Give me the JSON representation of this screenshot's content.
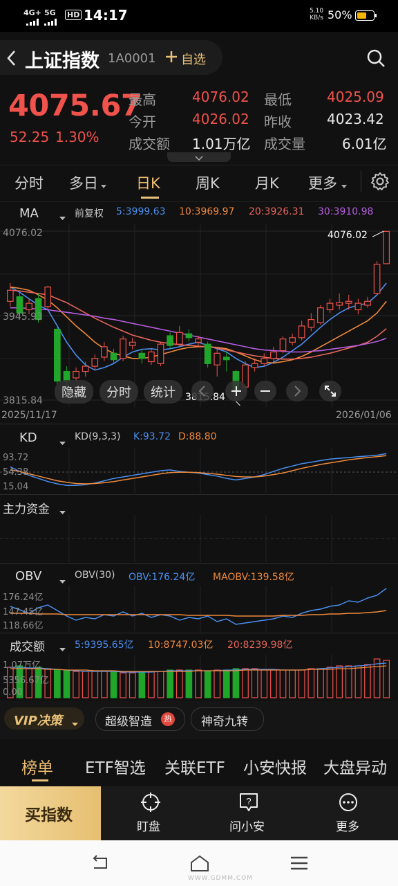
{
  "status_bar": {
    "signal": "4G+",
    "signal2": "5G",
    "hd": "HD",
    "time": "14:17",
    "net_speed_value": "5.10",
    "net_speed_unit": "KB/s",
    "battery": "50%"
  },
  "header": {
    "back_icon": "chevron-left-icon",
    "title": "上证指数",
    "code": "1A0001",
    "watchlist_label": "自选",
    "search_icon": "search-icon"
  },
  "quote": {
    "price": "4075.67",
    "change": "52.25",
    "change_pct": "1.30%",
    "high_label": "最高",
    "high_value": "4076.02",
    "low_label": "最低",
    "low_value": "4025.09",
    "open_label": "今开",
    "open_value": "4026.02",
    "prev_close_label": "昨收",
    "prev_close_value": "4023.42",
    "turnover_label": "成交额",
    "turnover_value": "1.01万亿",
    "volume_label": "成交量",
    "volume_value": "6.01亿"
  },
  "tabs": [
    {
      "label": "分时"
    },
    {
      "label": "多日"
    },
    {
      "label": "日K"
    },
    {
      "label": "周K"
    },
    {
      "label": "月K"
    },
    {
      "label": "更多"
    }
  ],
  "main_chart": {
    "indicator": "MA",
    "adjust": "前复权",
    "ma5": "5:3999.63",
    "ma10": "10:3969.97",
    "ma20": "20:3926.31",
    "ma30": "30:3910.98",
    "y_top": "4076.02",
    "y_mid": "3945.93",
    "y_bottom": "3815.84",
    "max_label": "4076.02",
    "min_label": "3815.84",
    "date_start": "2025/11/17",
    "date_end": "2026/01/06",
    "buttons": {
      "hide": "隐藏",
      "intraday": "分时",
      "stats": "统计"
    }
  },
  "kd": {
    "name": "KD",
    "params": "KD(9,3,3)",
    "k": "K:93.72",
    "d": "D:88.80",
    "y1": "93.72",
    "y2": "54.38",
    "y3": "15.04"
  },
  "main_funds": {
    "label": "主力资金"
  },
  "obv": {
    "name": "OBV",
    "params": "OBV(30)",
    "obv": "OBV:176.24亿",
    "maobv": "MAOBV:139.58亿",
    "y1": "176.24亿",
    "y2": "147.45亿",
    "y3": "118.66亿"
  },
  "turnover_chart": {
    "name": "成交额",
    "ma5": "5:9395.65亿",
    "ma10": "10:8747.03亿",
    "ma20": "20:8239.98亿",
    "y1": "1.07万亿",
    "y2": "5356.67亿",
    "y3": "0.00"
  },
  "strategy_bar": {
    "vip": "VIP决策",
    "super": "超级智造",
    "hot": "热",
    "magic": "神奇九转"
  },
  "news_tabs": [
    {
      "label": "榜单"
    },
    {
      "label": "ETF智选"
    },
    {
      "label": "关联ETF"
    },
    {
      "label": "小安快报"
    },
    {
      "label": "大盘异动"
    }
  ],
  "bottom_nav": {
    "buy": "买指数",
    "watch": "盯盘",
    "ask": "问小安",
    "more": "更多"
  },
  "watermark": "WWW.GDMM.COM",
  "colors": {
    "up": "#f0524c",
    "down": "#21a62b",
    "ma5": "#4a8ff0",
    "ma10": "#f08a3c",
    "ma20": "#e8655a",
    "ma30": "#b65ee0",
    "accent": "#e9c27a"
  },
  "chart_data": {
    "type": "candlestick",
    "title": "上证指数 日K",
    "x_range": [
      "2025/11/17",
      "2026/01/06"
    ],
    "ylim": [
      3815.84,
      4076.02
    ],
    "candles": [
      {
        "o": 3968,
        "c": 3985,
        "h": 3996,
        "l": 3960
      },
      {
        "o": 3975,
        "c": 3950,
        "h": 3982,
        "l": 3942
      },
      {
        "o": 3955,
        "c": 3965,
        "h": 3972,
        "l": 3948
      },
      {
        "o": 3972,
        "c": 3940,
        "h": 3980,
        "l": 3935
      },
      {
        "o": 3960,
        "c": 3990,
        "h": 3992,
        "l": 3955
      },
      {
        "o": 3925,
        "c": 3845,
        "h": 3928,
        "l": 3840
      },
      {
        "o": 3860,
        "c": 3845,
        "h": 3868,
        "l": 3835
      },
      {
        "o": 3850,
        "c": 3860,
        "h": 3866,
        "l": 3845
      },
      {
        "o": 3860,
        "c": 3868,
        "h": 3875,
        "l": 3852
      },
      {
        "o": 3868,
        "c": 3880,
        "h": 3886,
        "l": 3862
      },
      {
        "o": 3882,
        "c": 3898,
        "h": 3905,
        "l": 3876
      },
      {
        "o": 3888,
        "c": 3878,
        "h": 3895,
        "l": 3872
      },
      {
        "o": 3880,
        "c": 3910,
        "h": 3915,
        "l": 3876
      },
      {
        "o": 3900,
        "c": 3905,
        "h": 3912,
        "l": 3894
      },
      {
        "o": 3888,
        "c": 3880,
        "h": 3895,
        "l": 3872
      },
      {
        "o": 3875,
        "c": 3890,
        "h": 3896,
        "l": 3870
      },
      {
        "o": 3872,
        "c": 3902,
        "h": 3906,
        "l": 3868
      },
      {
        "o": 3915,
        "c": 3900,
        "h": 3920,
        "l": 3895
      },
      {
        "o": 3902,
        "c": 3920,
        "h": 3930,
        "l": 3898
      },
      {
        "o": 3918,
        "c": 3912,
        "h": 3925,
        "l": 3906
      },
      {
        "o": 3905,
        "c": 3910,
        "h": 3915,
        "l": 3900
      },
      {
        "o": 3902,
        "c": 3872,
        "h": 3906,
        "l": 3866
      },
      {
        "o": 3870,
        "c": 3888,
        "h": 3895,
        "l": 3852
      },
      {
        "o": 3882,
        "c": 3878,
        "h": 3890,
        "l": 3860
      },
      {
        "o": 3860,
        "c": 3830,
        "h": 3862,
        "l": 3816
      },
      {
        "o": 3836,
        "c": 3870,
        "h": 3876,
        "l": 3832
      },
      {
        "o": 3866,
        "c": 3872,
        "h": 3880,
        "l": 3860
      },
      {
        "o": 3872,
        "c": 3880,
        "h": 3888,
        "l": 3868
      },
      {
        "o": 3880,
        "c": 3890,
        "h": 3898,
        "l": 3874
      },
      {
        "o": 3892,
        "c": 3910,
        "h": 3914,
        "l": 3888
      },
      {
        "o": 3905,
        "c": 3912,
        "h": 3918,
        "l": 3900
      },
      {
        "o": 3912,
        "c": 3930,
        "h": 3938,
        "l": 3908
      },
      {
        "o": 3928,
        "c": 3940,
        "h": 3950,
        "l": 3922
      },
      {
        "o": 3935,
        "c": 3958,
        "h": 3962,
        "l": 3932
      },
      {
        "o": 3955,
        "c": 3965,
        "h": 3972,
        "l": 3950
      },
      {
        "o": 3962,
        "c": 3966,
        "h": 3980,
        "l": 3955
      },
      {
        "o": 3965,
        "c": 3968,
        "h": 3978,
        "l": 3955
      },
      {
        "o": 3955,
        "c": 3965,
        "h": 3972,
        "l": 3948
      },
      {
        "o": 3962,
        "c": 3968,
        "h": 3975,
        "l": 3958
      },
      {
        "o": 3980,
        "c": 4025,
        "h": 4030,
        "l": 3978
      },
      {
        "o": 4026,
        "c": 4075.67,
        "h": 4076.02,
        "l": 4025.09
      }
    ],
    "ma_series": [
      {
        "name": "MA5",
        "values": [
          3990,
          3982,
          3972,
          3962,
          3955,
          3930,
          3905,
          3885,
          3870,
          3862,
          3866,
          3872,
          3882,
          3890,
          3894,
          3895,
          3893,
          3895,
          3898,
          3902,
          3905,
          3900,
          3895,
          3890,
          3880,
          3872,
          3866,
          3868,
          3874,
          3882,
          3892,
          3902,
          3915,
          3928,
          3940,
          3950,
          3958,
          3962,
          3965,
          3978,
          3996
        ]
      },
      {
        "name": "MA10",
        "values": [
          3990,
          3988,
          3985,
          3978,
          3970,
          3958,
          3944,
          3930,
          3918,
          3905,
          3895,
          3888,
          3884,
          3880,
          3880,
          3882,
          3886,
          3890,
          3894,
          3897,
          3898,
          3898,
          3897,
          3895,
          3890,
          3884,
          3878,
          3874,
          3873,
          3875,
          3878,
          3883,
          3890,
          3898,
          3906,
          3914,
          3922,
          3930,
          3938,
          3950,
          3968
        ]
      },
      {
        "name": "MA20",
        "values": [
          3985,
          3984,
          3982,
          3980,
          3978,
          3972,
          3966,
          3958,
          3950,
          3942,
          3935,
          3928,
          3922,
          3916,
          3912,
          3908,
          3905,
          3903,
          3901,
          3900,
          3899,
          3898,
          3896,
          3893,
          3890,
          3887,
          3884,
          3882,
          3880,
          3879,
          3879,
          3880,
          3882,
          3885,
          3888,
          3892,
          3896,
          3900,
          3905,
          3914,
          3926
        ]
      },
      {
        "name": "MA30",
        "values": [
          3958,
          3958,
          3957,
          3956,
          3955,
          3953,
          3951,
          3949,
          3947,
          3945,
          3942,
          3940,
          3937,
          3934,
          3931,
          3928,
          3925,
          3922,
          3919,
          3916,
          3913,
          3910,
          3907,
          3904,
          3901,
          3898,
          3895,
          3893,
          3892,
          3891,
          3890,
          3890,
          3891,
          3892,
          3894,
          3896,
          3898,
          3900,
          3903,
          3906,
          3911
        ]
      }
    ]
  }
}
